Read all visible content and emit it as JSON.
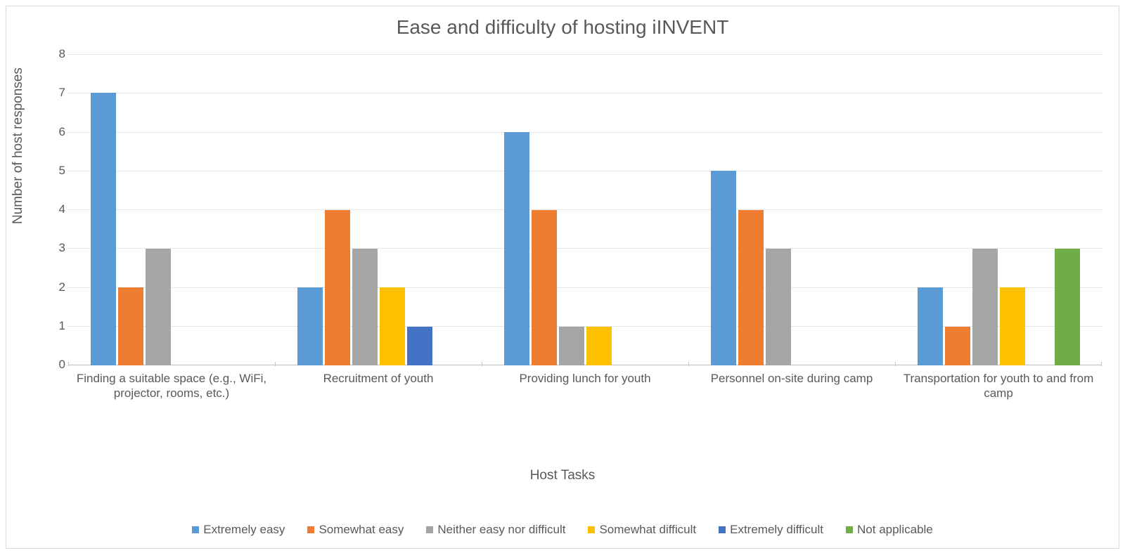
{
  "chart_data": {
    "type": "bar",
    "title": "Ease and difficulty of hosting iINVENT",
    "xlabel": "Host Tasks",
    "ylabel": "Number of host responses",
    "ylim": [
      0,
      8
    ],
    "y_ticks": [
      0,
      1,
      2,
      3,
      4,
      5,
      6,
      7,
      8
    ],
    "categories": [
      "Finding a suitable space (e.g., WiFi, projector, rooms, etc.)",
      "Recruitment of youth",
      "Providing lunch for youth",
      "Personnel on-site during camp",
      "Transportation for youth to and from camp"
    ],
    "series": [
      {
        "name": "Extremely easy",
        "color": "#5b9bd5",
        "values": [
          7,
          2,
          6,
          5,
          2
        ]
      },
      {
        "name": "Somewhat easy",
        "color": "#ed7d31",
        "values": [
          2,
          4,
          4,
          4,
          1
        ]
      },
      {
        "name": "Neither easy nor difficult",
        "color": "#a5a5a5",
        "values": [
          3,
          3,
          1,
          3,
          3
        ]
      },
      {
        "name": "Somewhat difficult",
        "color": "#ffc000",
        "values": [
          0,
          2,
          1,
          0,
          2
        ]
      },
      {
        "name": "Extremely difficult",
        "color": "#4472c4",
        "values": [
          0,
          1,
          0,
          0,
          0
        ]
      },
      {
        "name": "Not applicable",
        "color": "#70ad47",
        "values": [
          0,
          0,
          0,
          0,
          3
        ]
      }
    ],
    "legend_position": "bottom"
  }
}
